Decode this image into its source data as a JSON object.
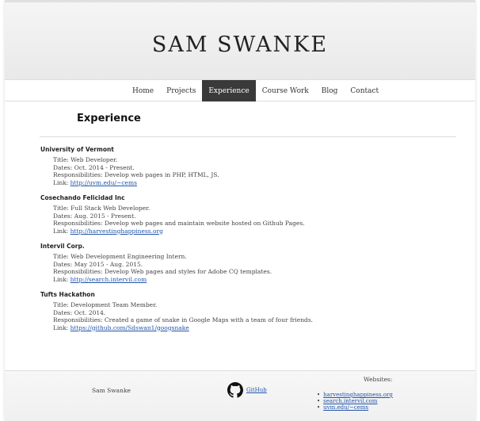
{
  "header": {
    "title": "SAM SWANKE"
  },
  "nav": {
    "items": [
      {
        "label": "Home"
      },
      {
        "label": "Projects"
      },
      {
        "label": "Experience",
        "active": true
      },
      {
        "label": "Course Work"
      },
      {
        "label": "Blog"
      },
      {
        "label": "Contact"
      }
    ]
  },
  "main": {
    "heading": "Experience",
    "jobs": [
      {
        "company": "University of Vermont",
        "title": "Title: Web Developer.",
        "dates": "Dates: Oct. 2014 - Present.",
        "responsibilities": "Responsibilities: Develop web pages in PHP, HTML, JS.",
        "link_prefix": "Link:",
        "link_text": "http://uvm.edu/~cems"
      },
      {
        "company": "Cosechando Felicidad Inc",
        "title": "Title: Full Stack Web Developer.",
        "dates": "Dates: Aug. 2015 - Present.",
        "responsibilities": "Responsibilities: Develop web pages and maintain website hosted on Github Pages.",
        "link_prefix": "Link:",
        "link_text": "http://harvestinghappiness.org"
      },
      {
        "company": "Intervil Corp.",
        "title": "Title: Web Development Engineering Intern.",
        "dates": "Dates: May 2015 - Aug. 2015.",
        "responsibilities": "Responsibilities: Develop Web pages and styles for Adobe CQ templates.",
        "link_prefix": "Link:",
        "link_text": "http://search.intervil.com"
      },
      {
        "company": "Tufts Hackathon",
        "title": "Title: Development Team Member.",
        "dates": "Dates: Oct. 2014.",
        "responsibilities": "Responsibilities: Created a game of snake in Google Maps with a team of four friends.",
        "link_prefix": "Link:",
        "link_text": "https://github.com/Sdswan1/googsnake"
      }
    ]
  },
  "footer": {
    "name": "Sam Swanke",
    "github_label": "GitHub",
    "icon": "github-icon",
    "websites_title": "Websites:",
    "websites": [
      "harvestinghappiness.org",
      "search.intervil.com",
      "uvm.edu/~cems"
    ]
  }
}
